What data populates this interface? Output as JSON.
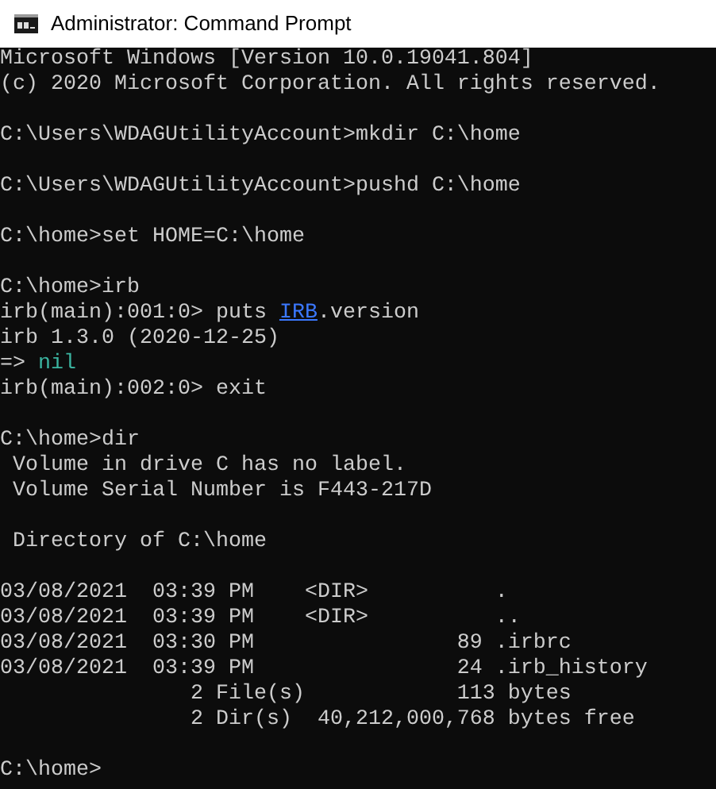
{
  "window": {
    "title": "Administrator: Command Prompt"
  },
  "console": {
    "lines": [
      {
        "kind": "text",
        "segments": [
          {
            "kind": "plain",
            "text": "Microsoft Windows [Version 10.0.19041.804]"
          }
        ]
      },
      {
        "kind": "text",
        "segments": [
          {
            "kind": "plain",
            "text": "(c) 2020 Microsoft Corporation. All rights reserved."
          }
        ]
      },
      {
        "kind": "blank"
      },
      {
        "kind": "text",
        "segments": [
          {
            "kind": "plain",
            "text": "C:\\Users\\WDAGUtilityAccount>mkdir C:\\home"
          }
        ]
      },
      {
        "kind": "blank"
      },
      {
        "kind": "text",
        "segments": [
          {
            "kind": "plain",
            "text": "C:\\Users\\WDAGUtilityAccount>pushd C:\\home"
          }
        ]
      },
      {
        "kind": "blank"
      },
      {
        "kind": "text",
        "segments": [
          {
            "kind": "plain",
            "text": "C:\\home>set HOME=C:\\home"
          }
        ]
      },
      {
        "kind": "blank"
      },
      {
        "kind": "text",
        "segments": [
          {
            "kind": "plain",
            "text": "C:\\home>irb"
          }
        ]
      },
      {
        "kind": "text",
        "segments": [
          {
            "kind": "plain",
            "text": "irb(main):001:0> puts "
          },
          {
            "kind": "constant",
            "text": "IRB"
          },
          {
            "kind": "plain",
            "text": ".version"
          }
        ]
      },
      {
        "kind": "text",
        "segments": [
          {
            "kind": "plain",
            "text": "irb 1.3.0 (2020-12-25)"
          }
        ]
      },
      {
        "kind": "text",
        "segments": [
          {
            "kind": "plain",
            "text": "=> "
          },
          {
            "kind": "value",
            "text": "nil"
          }
        ]
      },
      {
        "kind": "text",
        "segments": [
          {
            "kind": "plain",
            "text": "irb(main):002:0> exit"
          }
        ]
      },
      {
        "kind": "blank"
      },
      {
        "kind": "text",
        "segments": [
          {
            "kind": "plain",
            "text": "C:\\home>dir"
          }
        ]
      },
      {
        "kind": "text",
        "segments": [
          {
            "kind": "plain",
            "text": " Volume in drive C has no label."
          }
        ]
      },
      {
        "kind": "text",
        "segments": [
          {
            "kind": "plain",
            "text": " Volume Serial Number is F443-217D"
          }
        ]
      },
      {
        "kind": "blank"
      },
      {
        "kind": "text",
        "segments": [
          {
            "kind": "plain",
            "text": " Directory of C:\\home"
          }
        ]
      },
      {
        "kind": "blank"
      },
      {
        "kind": "text",
        "segments": [
          {
            "kind": "plain",
            "text": "03/08/2021  03:39 PM    <DIR>          ."
          }
        ]
      },
      {
        "kind": "text",
        "segments": [
          {
            "kind": "plain",
            "text": "03/08/2021  03:39 PM    <DIR>          .."
          }
        ]
      },
      {
        "kind": "text",
        "segments": [
          {
            "kind": "plain",
            "text": "03/08/2021  03:30 PM                89 .irbrc"
          }
        ]
      },
      {
        "kind": "text",
        "segments": [
          {
            "kind": "plain",
            "text": "03/08/2021  03:39 PM                24 .irb_history"
          }
        ]
      },
      {
        "kind": "text",
        "segments": [
          {
            "kind": "plain",
            "text": "               2 File(s)            113 bytes"
          }
        ]
      },
      {
        "kind": "text",
        "segments": [
          {
            "kind": "plain",
            "text": "               2 Dir(s)  40,212,000,768 bytes free"
          }
        ]
      },
      {
        "kind": "blank"
      },
      {
        "kind": "text",
        "segments": [
          {
            "kind": "plain",
            "text": "C:\\home>"
          }
        ]
      }
    ]
  }
}
